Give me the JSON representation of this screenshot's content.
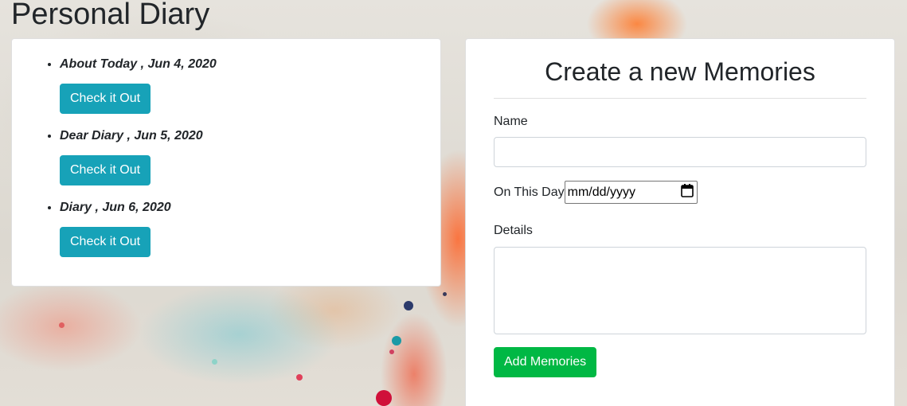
{
  "page_title": "Personal Diary",
  "entries": [
    {
      "title": "About Today , Jun 4, 2020",
      "button": "Check it Out"
    },
    {
      "title": "Dear Diary , Jun 5, 2020",
      "button": "Check it Out"
    },
    {
      "title": "Diary , Jun 6, 2020",
      "button": "Check it Out"
    }
  ],
  "form": {
    "title": "Create a new Memories",
    "name_label": "Name",
    "name_value": "",
    "date_label": "On This Day",
    "date_placeholder": "mm/dd/yyyy",
    "details_label": "Details",
    "details_value": "",
    "submit_label": "Add Memories"
  },
  "colors": {
    "info_button": "#17a2b8",
    "success_button": "#00b844"
  }
}
